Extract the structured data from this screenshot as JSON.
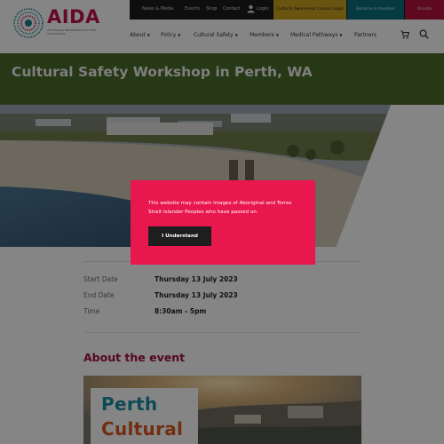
{
  "header": {
    "logo_text": "AIDA",
    "logo_subtitle": "AUSTRALIAN INDIGENOUS DOCTORS' ASSOCIATION",
    "topbar": {
      "links": [
        "News & Media",
        "Events",
        "Shop",
        "Contact"
      ],
      "login_label": "Login",
      "cultural_awareness_label": "Cultural Awareness Course Login",
      "become_member_label": "Become a member",
      "donate_label": "Donate"
    },
    "main_nav": [
      "About",
      "Policy",
      "Cultural Safety",
      "Members",
      "Medical Pathways",
      "Partners"
    ],
    "cart_icon": "cart-icon",
    "search_icon": "search-icon"
  },
  "page": {
    "title": "Cultural Safety Workshop in Perth, WA"
  },
  "event": {
    "start_date_label": "Start Date",
    "start_date_value": "Thursday 13 July 2023",
    "end_date_label": "End Date",
    "end_date_value": "Thursday 13 July 2023",
    "time_label": "Time",
    "time_value": "8:30am - 5pm"
  },
  "about": {
    "heading": "About the event",
    "poster_line1": "Perth",
    "poster_line2": "Cultural"
  },
  "modal": {
    "message": "This website may contain images of Aboriginal and Torres Strait Islander Peoples who have passed on.",
    "button_label": "I Understand"
  },
  "colors": {
    "brand": "#c1124b",
    "title_band": "#4a6b2a",
    "modal_bg": "#e8174d",
    "poster_teal": "#1a8fa0",
    "poster_orange": "#d9561e"
  }
}
